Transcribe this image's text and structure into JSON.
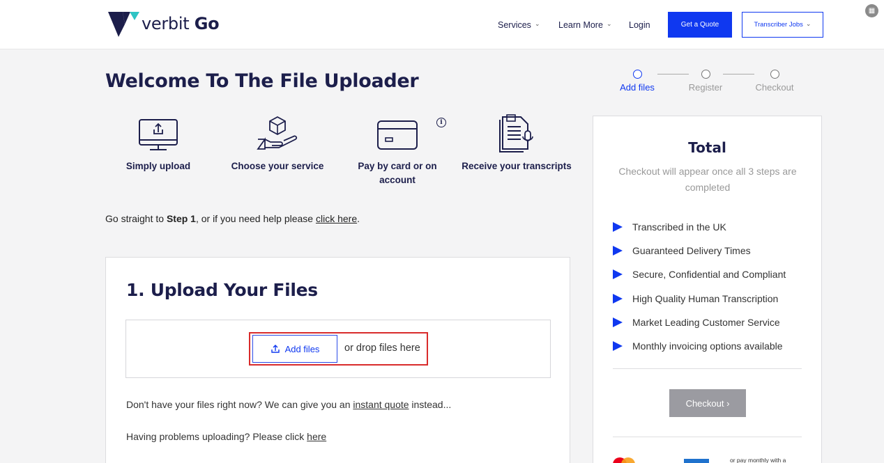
{
  "header": {
    "logo_text_light": "verbit",
    "logo_text_bold": "Go",
    "nav": {
      "services": "Services",
      "learn_more": "Learn More",
      "login": "Login"
    },
    "get_quote": "Get a Quote",
    "transcriber_jobs": "Transcriber Jobs"
  },
  "page_title": "Welcome To The File Uploader",
  "features": [
    {
      "label": "Simply upload",
      "icon": "monitor-upload-icon"
    },
    {
      "label": "Choose your service",
      "icon": "hand-cube-icon"
    },
    {
      "label": "Pay by card or on account",
      "icon": "credit-card-icon"
    },
    {
      "label": "Receive your transcripts",
      "icon": "document-mic-icon"
    }
  ],
  "info_glyph": "i",
  "help": {
    "prefix": "Go straight to ",
    "step": "Step 1",
    "middle": ", or if you need help please ",
    "link": "click here",
    "suffix": "."
  },
  "upload": {
    "title": "1. Upload Your Files",
    "add_files": "Add files",
    "drop_text": "or drop files here",
    "no_files_prefix": "Don't have your files right now? We can give you an ",
    "instant_quote": "instant quote",
    "no_files_suffix": " instead...",
    "problems_prefix": "Having problems uploading? Please click ",
    "problems_link": "here"
  },
  "steps": [
    {
      "label": "Add files",
      "active": true
    },
    {
      "label": "Register",
      "active": false
    },
    {
      "label": "Checkout",
      "active": false
    }
  ],
  "total": {
    "title": "Total",
    "subtitle": "Checkout will appear once all 3 steps are completed",
    "benefits": [
      "Transcribed in the UK",
      "Guaranteed Delivery Times",
      "Secure, Confidential and Compliant",
      "High Quality Human Transcription",
      "Market Leading Customer Service",
      "Monthly invoicing options available"
    ],
    "checkout": "Checkout ›",
    "pay_monthly": "or pay monthly with a"
  },
  "colors": {
    "brand_navy": "#1c1e4b",
    "accent_blue": "#0f38f0",
    "logo_teal": "#2ec4c4",
    "highlight_red": "#d92b2b"
  }
}
